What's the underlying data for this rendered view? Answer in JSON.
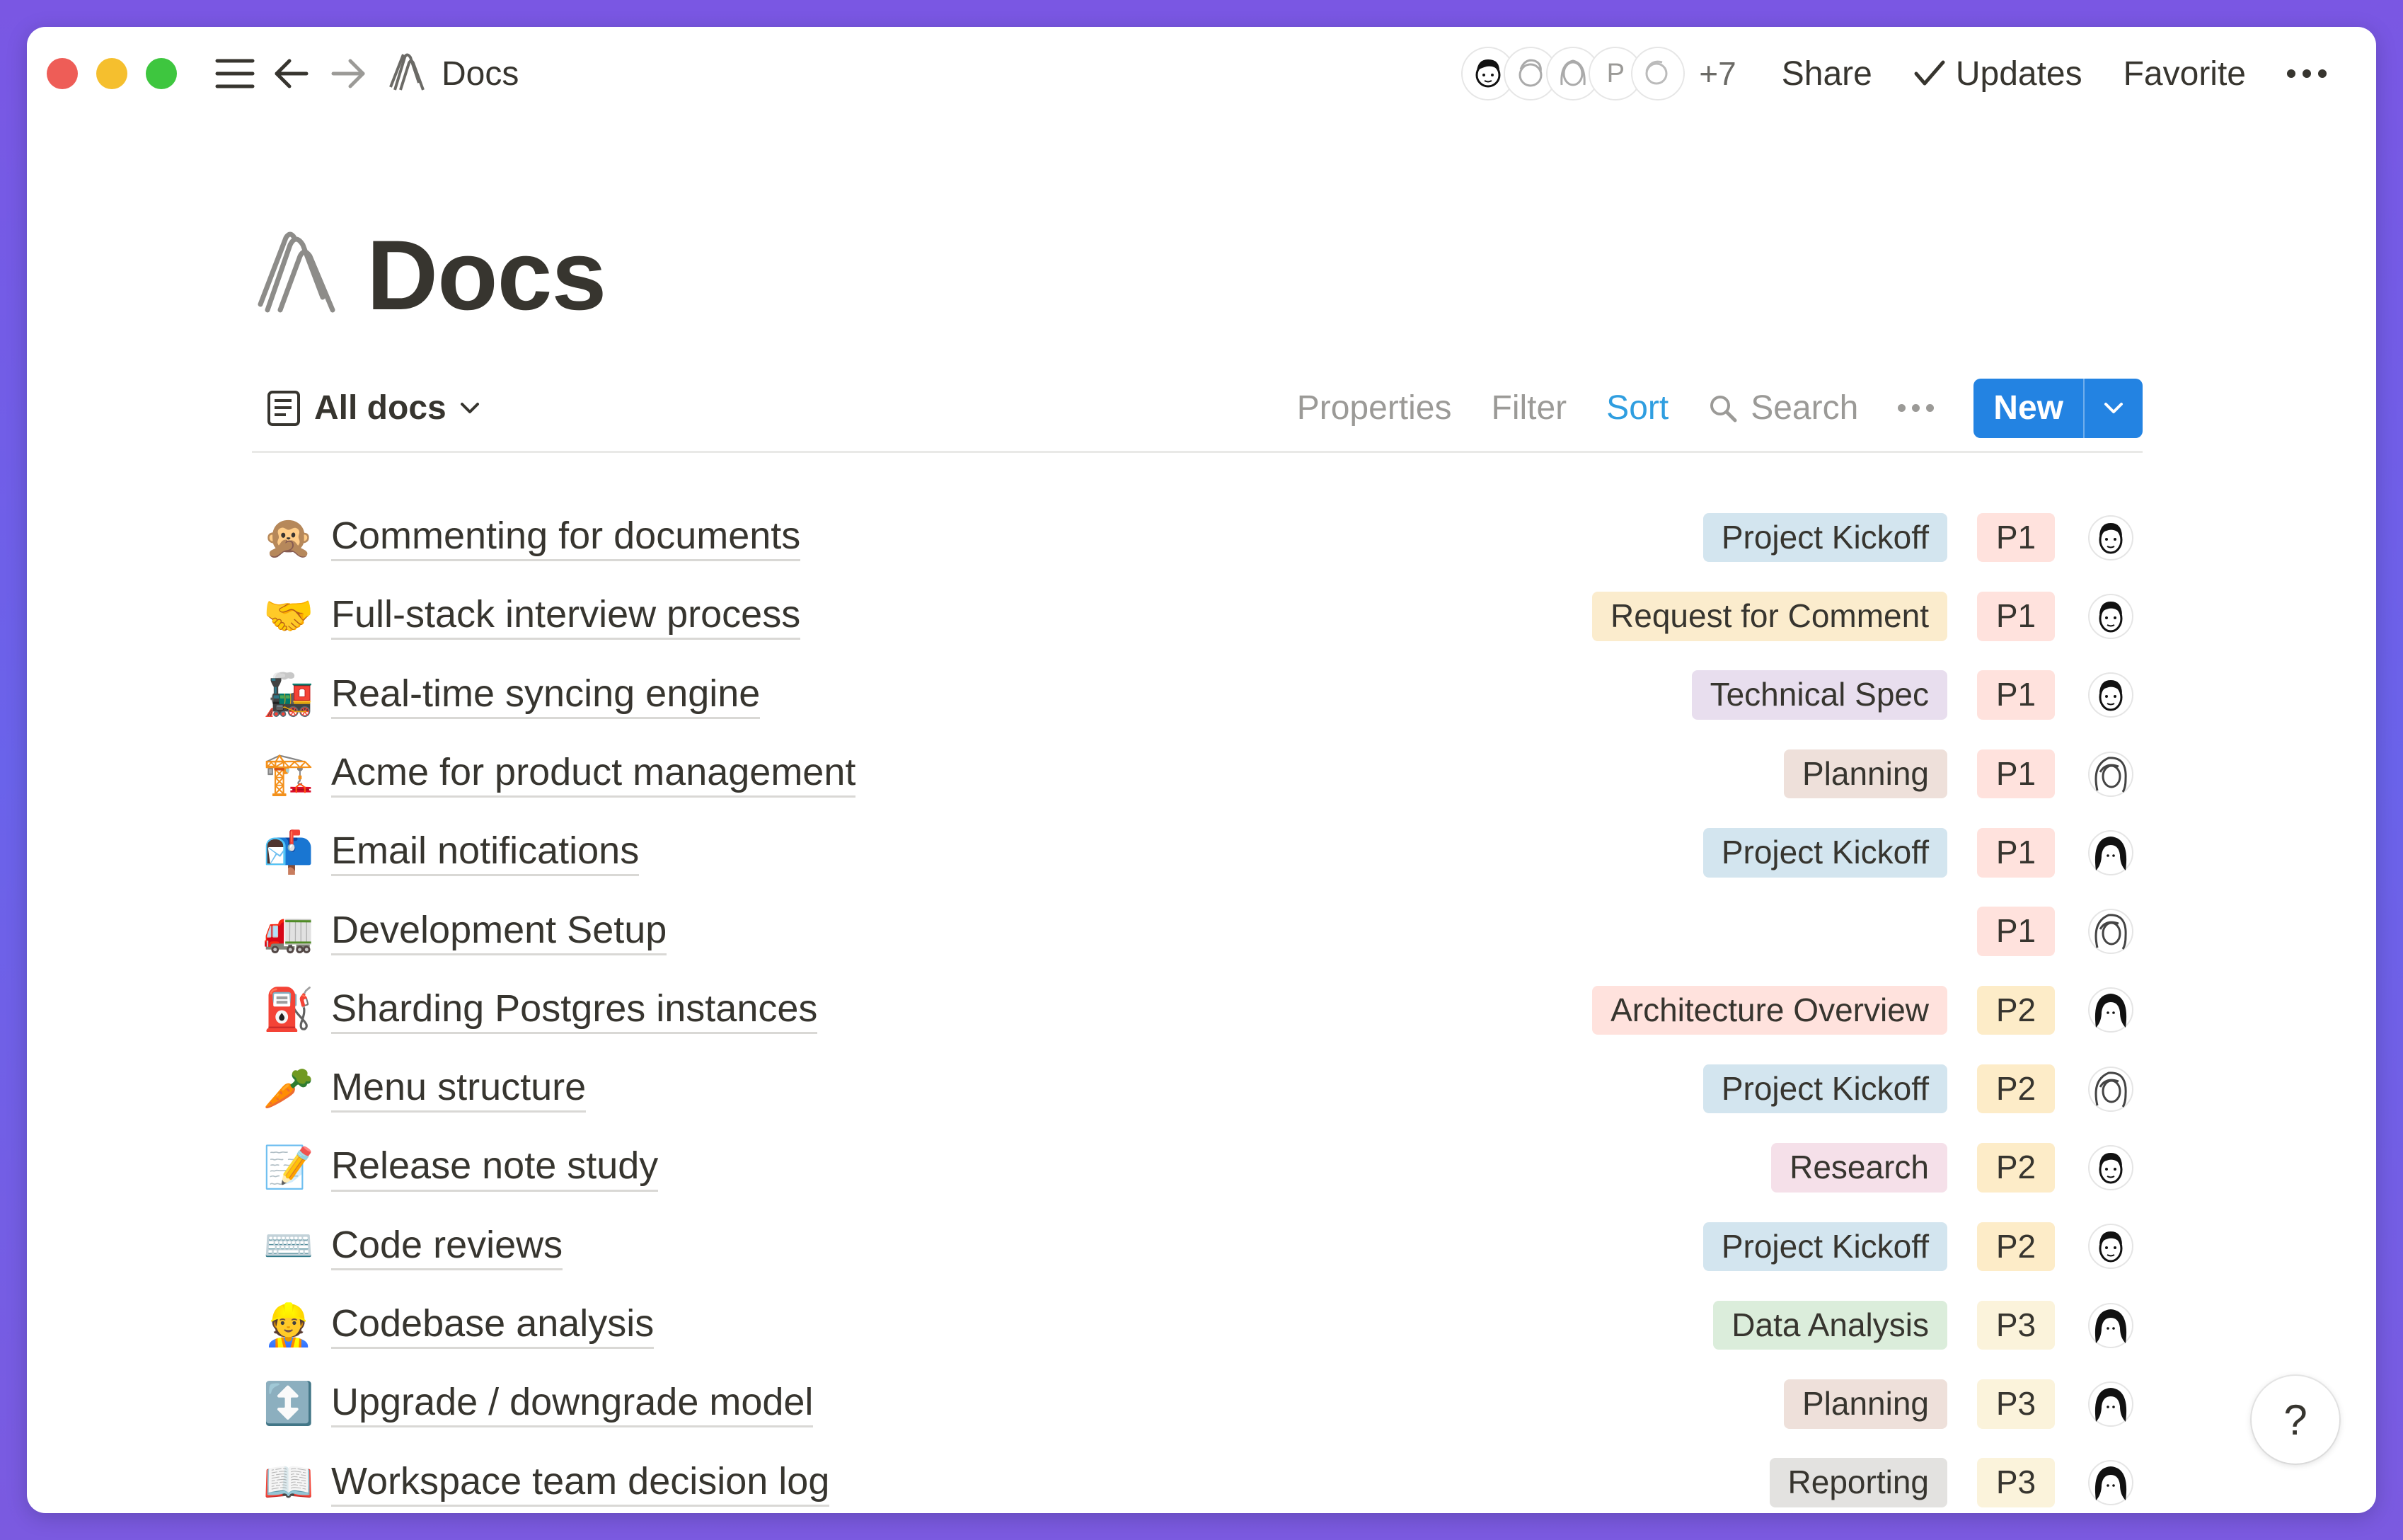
{
  "topbar": {
    "breadcrumb": "Docs",
    "avatar_letter": "P",
    "more_count": "+7",
    "share": "Share",
    "updates": "Updates",
    "favorite": "Favorite"
  },
  "page": {
    "title": "Docs"
  },
  "toolbar": {
    "view_label": "All docs",
    "properties": "Properties",
    "filter": "Filter",
    "sort": "Sort",
    "search": "Search",
    "new": "New"
  },
  "colors": {
    "blue_tag": "#d3e5ef",
    "yellow_tag": "#fbeccd",
    "purple_tag": "#e8deee",
    "brown_tag": "#eee0da",
    "red_tag": "#ffe2dd",
    "pink_tag": "#f5e0e9",
    "green_tag": "#dbeddb",
    "gray_tag": "#e3e2e0",
    "p1": "#ffe2dd",
    "p2": "#fdecc8",
    "p3": "#fbf3db",
    "accent": "#2383e2",
    "sort_active": "#2f9ee0"
  },
  "docs": [
    {
      "icon": "🙊",
      "title": "Commenting for documents",
      "tag": "Project Kickoff",
      "tag_color": "#d3e5ef",
      "priority": "P1"
    },
    {
      "icon": "🤝",
      "title": "Full-stack interview process",
      "tag": "Request for Comment",
      "tag_color": "#fbeccd",
      "priority": "P1"
    },
    {
      "icon": "🚂",
      "title": "Real-time syncing engine",
      "tag": "Technical Spec",
      "tag_color": "#e8deee",
      "priority": "P1"
    },
    {
      "icon": "🏗️",
      "title": "Acme for product management",
      "tag": "Planning",
      "tag_color": "#eee0da",
      "priority": "P1"
    },
    {
      "icon": "📬",
      "title": "Email notifications",
      "tag": "Project Kickoff",
      "tag_color": "#d3e5ef",
      "priority": "P1"
    },
    {
      "icon": "🚛",
      "title": "Development Setup",
      "tag": "",
      "tag_color": "",
      "priority": "P1"
    },
    {
      "icon": "⛽",
      "title": "Sharding Postgres instances",
      "tag": "Architecture Overview",
      "tag_color": "#ffe2dd",
      "priority": "P2"
    },
    {
      "icon": "🥕",
      "title": "Menu structure",
      "tag": "Project Kickoff",
      "tag_color": "#d3e5ef",
      "priority": "P2"
    },
    {
      "icon": "📝",
      "title": "Release note study",
      "tag": "Research",
      "tag_color": "#f5e0e9",
      "priority": "P2"
    },
    {
      "icon": "⌨️",
      "title": "Code reviews",
      "tag": "Project Kickoff",
      "tag_color": "#d3e5ef",
      "priority": "P2"
    },
    {
      "icon": "👷",
      "title": "Codebase analysis",
      "tag": "Data Analysis",
      "tag_color": "#dbeddb",
      "priority": "P3"
    },
    {
      "icon": "↕️",
      "title": "Upgrade / downgrade model",
      "tag": "Planning",
      "tag_color": "#eee0da",
      "priority": "P3"
    },
    {
      "icon": "📖",
      "title": "Workspace team decision log",
      "tag": "Reporting",
      "tag_color": "#e3e2e0",
      "priority": "P3"
    }
  ],
  "help": "?"
}
